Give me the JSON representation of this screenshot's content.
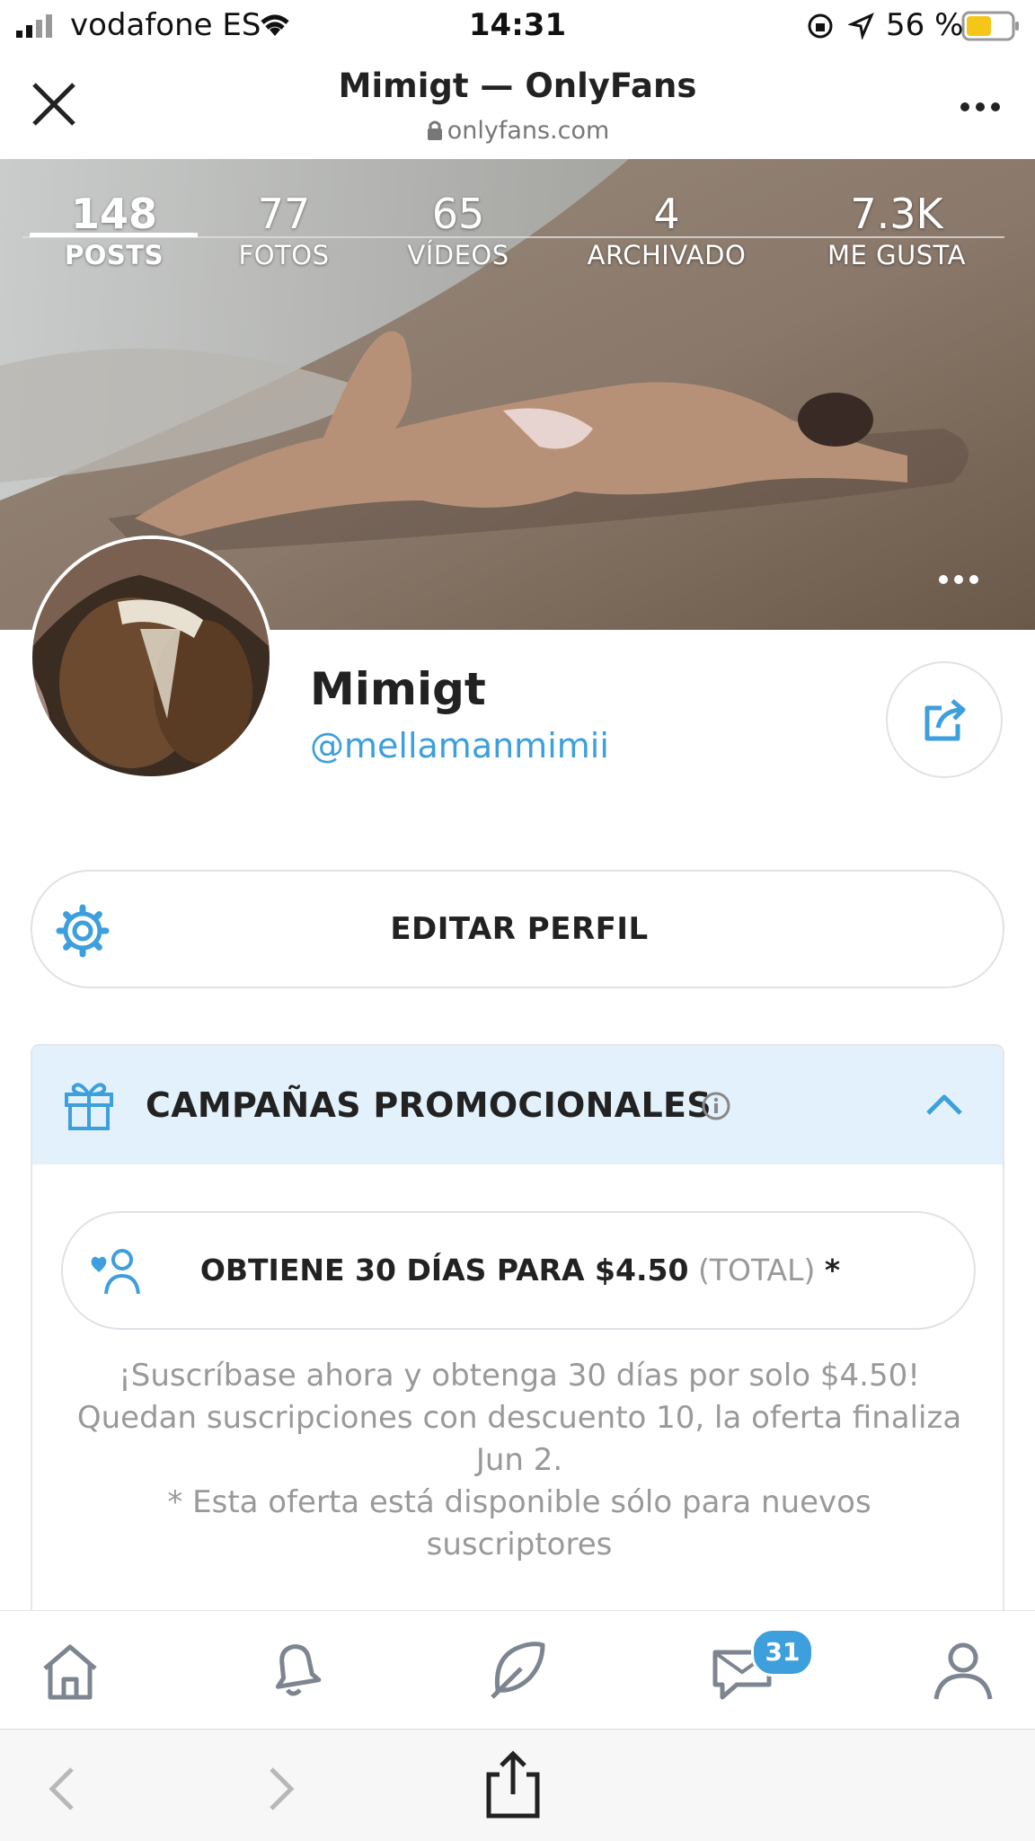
{
  "status_bar": {
    "carrier": "vodafone ES",
    "time": "14:31",
    "battery": "56 %"
  },
  "browser": {
    "title": "Mimigt — OnlyFans",
    "url": "onlyfans.com"
  },
  "stats": [
    {
      "value": "148",
      "label": "POSTS"
    },
    {
      "value": "77",
      "label": "FOTOS"
    },
    {
      "value": "65",
      "label": "VÍDEOS"
    },
    {
      "value": "4",
      "label": "ARCHIVADO"
    },
    {
      "value": "7.3K",
      "label": "ME GUSTA"
    }
  ],
  "profile": {
    "name": "Mimigt",
    "handle": "@mellamanmimii"
  },
  "edit_profile_label": "EDITAR PERFIL",
  "promo": {
    "title": "CAMPAÑAS PROMOCIONALES",
    "offer_main": "OBTIENE 30 DÍAS PARA $4.50",
    "offer_total": "(TOTAL)",
    "offer_star": "*",
    "desc_line1": "¡Suscríbase ahora y obtenga 30 días por solo $4.50!",
    "desc_line2": "Quedan suscripciones con descuento 10, la oferta finaliza Jun 2.",
    "desc_line3": "* Esta oferta está disponible sólo para nuevos suscriptores"
  },
  "tabbar": {
    "messages_badge": "31"
  },
  "colors": {
    "accent": "#3d9fdc",
    "promo_header_bg": "#e2f1fb"
  }
}
